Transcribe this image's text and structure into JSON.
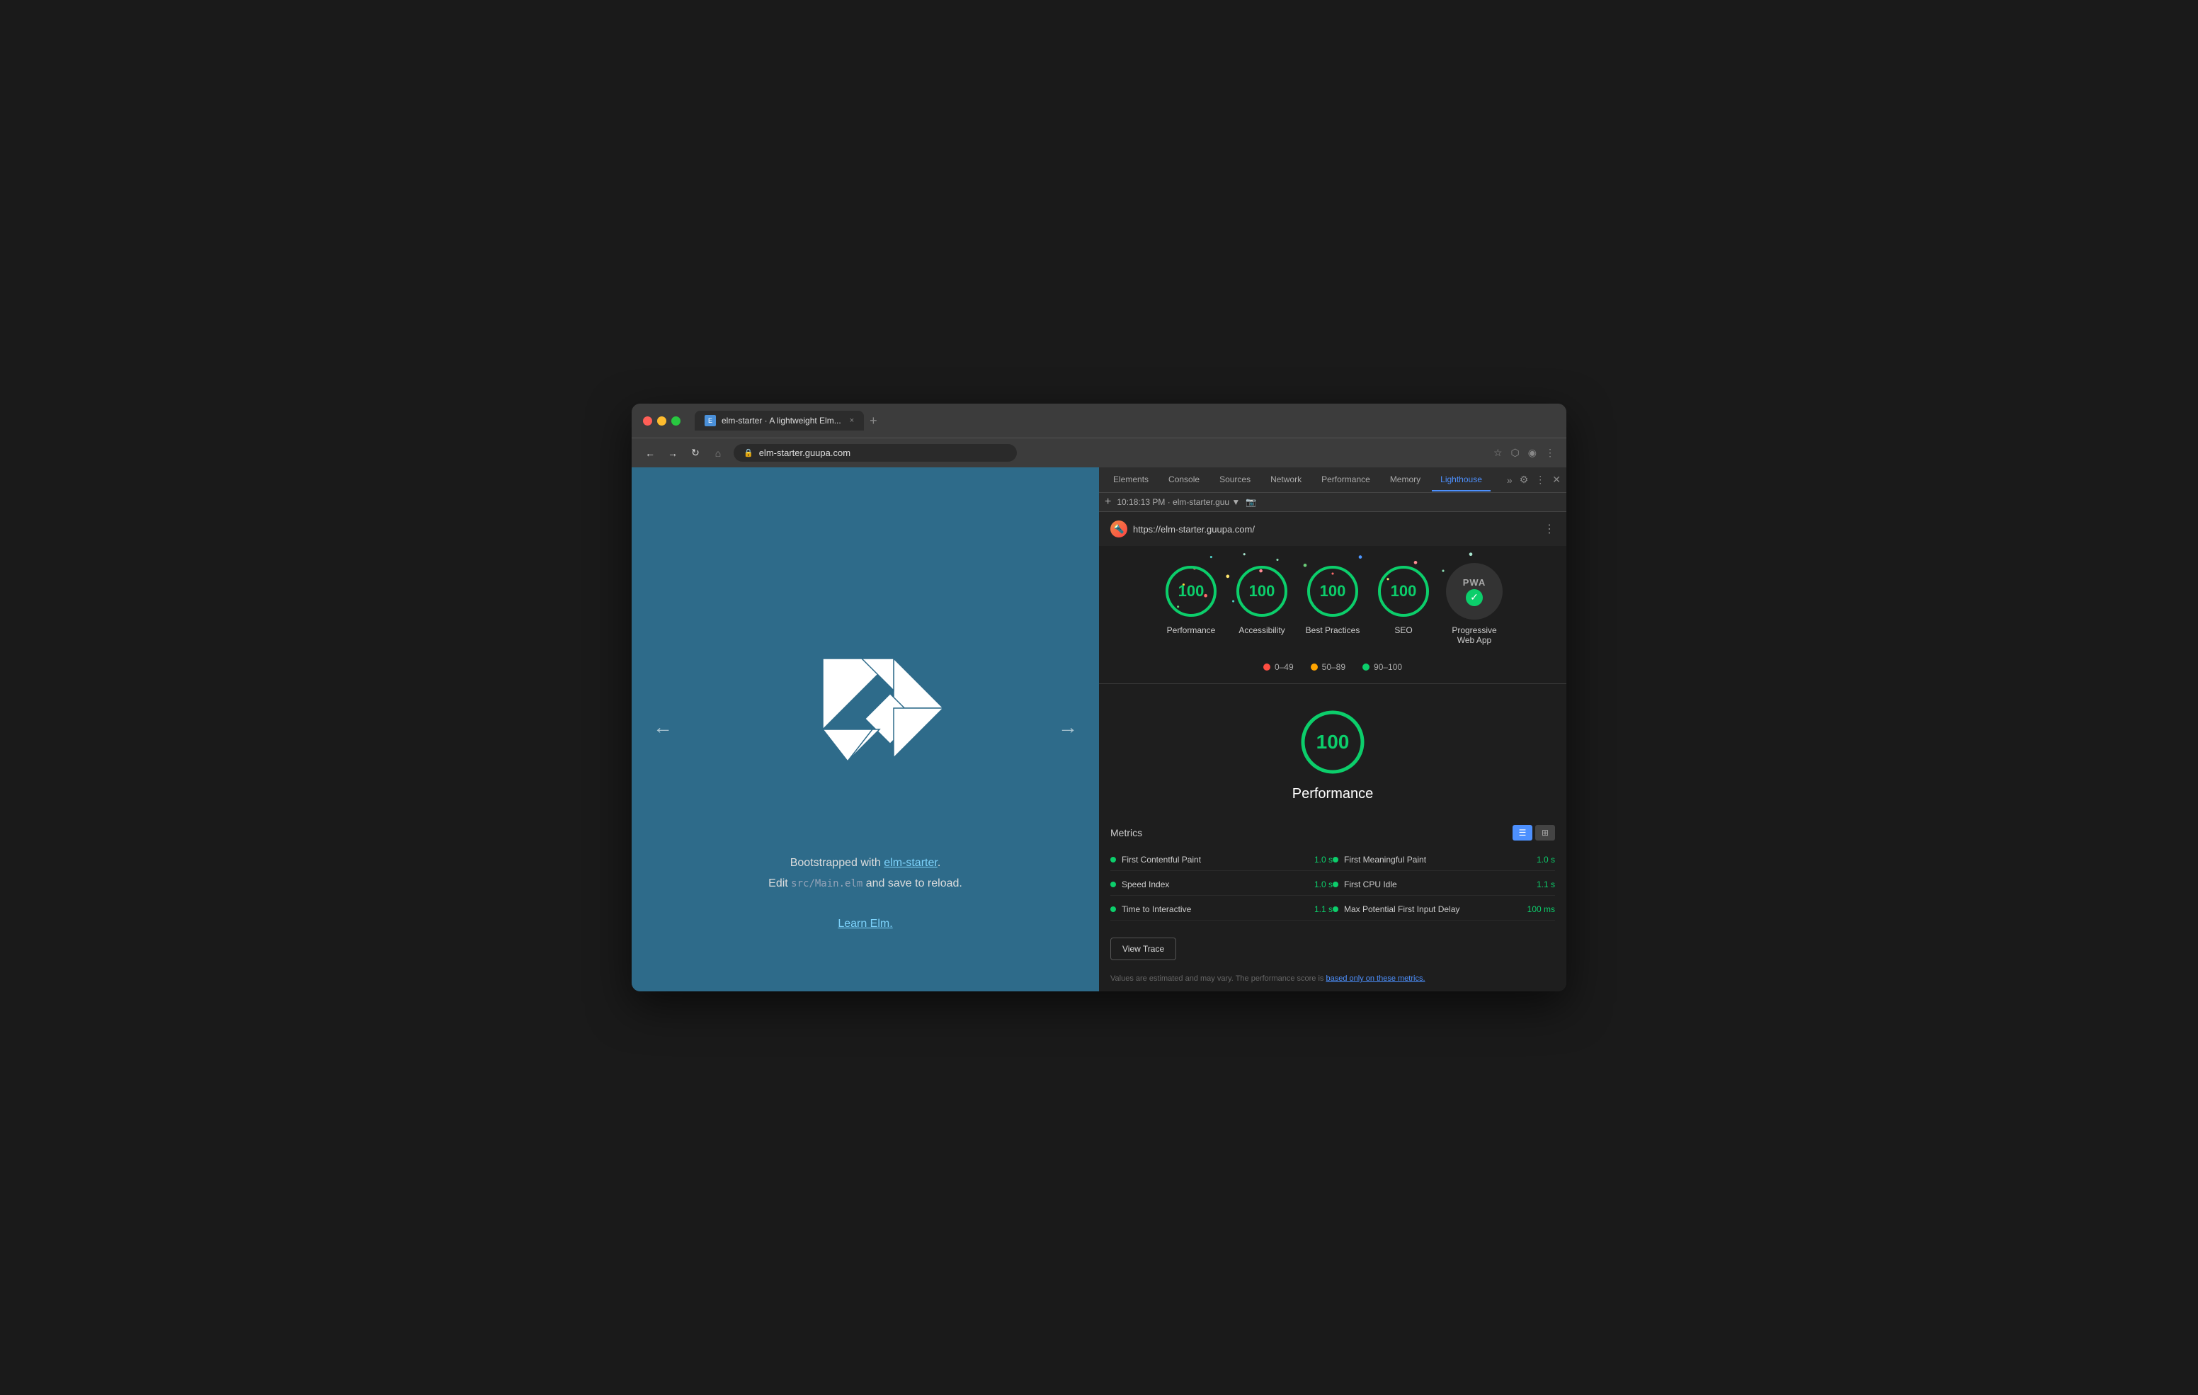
{
  "browser": {
    "traffic_lights": [
      "red",
      "yellow",
      "green"
    ],
    "tab": {
      "title": "elm-starter · A lightweight Elm...",
      "close_label": "×"
    },
    "new_tab_label": "+",
    "address": "elm-starter.guupa.com",
    "nav_buttons": [
      "←",
      "→",
      "↻",
      "⌂"
    ]
  },
  "devtools": {
    "tabs": [
      {
        "label": "Elements",
        "active": false
      },
      {
        "label": "Console",
        "active": false
      },
      {
        "label": "Sources",
        "active": false
      },
      {
        "label": "Network",
        "active": false
      },
      {
        "label": "Performance",
        "active": false
      },
      {
        "label": "Memory",
        "active": false
      },
      {
        "label": "Lighthouse",
        "active": true
      }
    ],
    "session": "10:18:13 PM · elm-starter.guu ▼",
    "lighthouse_url": "https://elm-starter.guupa.com/",
    "scores": [
      {
        "label": "Performance",
        "value": 100
      },
      {
        "label": "Accessibility",
        "value": 100
      },
      {
        "label": "Best Practices",
        "value": 100
      },
      {
        "label": "SEO",
        "value": 100
      },
      {
        "label": "Progressive Web App",
        "value": null,
        "pwa": true
      }
    ],
    "legend": [
      {
        "label": "0–49",
        "color": "red"
      },
      {
        "label": "50–89",
        "color": "orange"
      },
      {
        "label": "90–100",
        "color": "green"
      }
    ],
    "big_score": {
      "value": 100,
      "label": "Performance"
    },
    "metrics_title": "Metrics",
    "metrics": [
      {
        "name": "First Contentful Paint",
        "value": "1.0 s",
        "side": "left"
      },
      {
        "name": "First Meaningful Paint",
        "value": "1.0 s",
        "side": "right"
      },
      {
        "name": "Speed Index",
        "value": "1.0 s",
        "side": "left"
      },
      {
        "name": "First CPU Idle",
        "value": "1.1 s",
        "side": "right"
      },
      {
        "name": "Time to Interactive",
        "value": "1.1 s",
        "side": "left"
      },
      {
        "name": "Max Potential First Input Delay",
        "value": "100 ms",
        "side": "right"
      }
    ],
    "view_trace_label": "View Trace",
    "disclaimer": "Values are estimated and may vary. The performance score is",
    "disclaimer_link": "based only on these metrics."
  },
  "website": {
    "nav_left": "←",
    "nav_right": "→",
    "text_line1_pre": "Bootstrapped with ",
    "text_link": "elm-starter",
    "text_line1_post": ".",
    "text_line2_pre": "Edit ",
    "text_code": "src/Main.elm",
    "text_line2_post": " and save to reload.",
    "learn_link": "Learn Elm",
    "learn_link_dot": "."
  }
}
